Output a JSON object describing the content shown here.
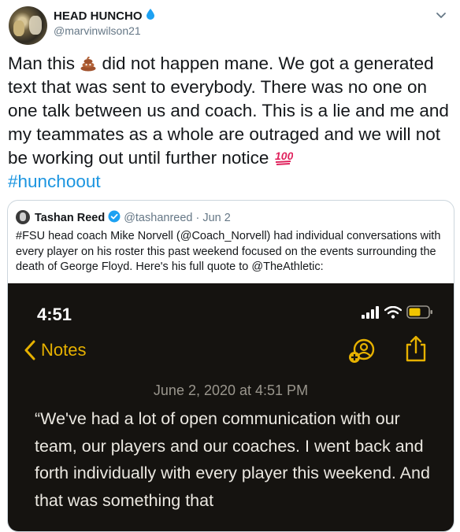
{
  "tweet": {
    "display_name": "HEAD HUNCHO",
    "handle": "@marvinwilson21",
    "text_part1": "Man this ",
    "text_part2": " did not happen mane. We got a generated text that was sent to everybody. There was no one on one talk between us and coach. This is a lie and me and my teammates as a whole are outraged and we will not be working out until further notice ",
    "hashtag": "#hunchoout",
    "icons": {
      "name_badge": "water-drop-icon",
      "menu": "chevron-down-icon",
      "emoji_1": "pile-of-poo-emoji",
      "emoji_2": "hundred-points-emoji"
    },
    "colors": {
      "link": "#1b95e0",
      "verified": "#1da1f2",
      "muted": "#657786"
    }
  },
  "quoted_tweet": {
    "display_name": "Tashan Reed",
    "handle": "@tashanreed",
    "separator": "·",
    "date": "Jun 2",
    "text": "#FSU head coach Mike Norvell (@Coach_Norvell) had individual conversations with every player on his roster this past weekend focused on the events surrounding the death of George Floyd. Here's his full quote to @TheAthletic:",
    "icons": {
      "verified": "verified-badge-icon"
    },
    "media": {
      "status_time": "4:51",
      "back_label": "Notes",
      "note_date": "June 2, 2020 at 4:51 PM",
      "note_text": "“We've had a lot of open communication with our team, our players and our coaches. I went back and forth individually with every player this weekend. And that was something that",
      "accent": "#e6b100",
      "icons": {
        "signal": "signal-bars-icon",
        "wifi": "wifi-icon",
        "battery": "battery-low-icon",
        "back": "chevron-left-icon",
        "collaborate": "add-person-icon",
        "share": "share-icon"
      }
    }
  }
}
